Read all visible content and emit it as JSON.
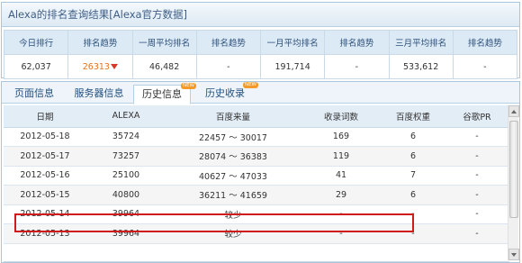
{
  "summary": {
    "title": "Alexa的排名查询结果[Alexa官方数据]",
    "headers": [
      "今日排行",
      "排名趋势",
      "一周平均排名",
      "排名趋势",
      "一月平均排名",
      "排名趋势",
      "三月平均排名",
      "排名趋势"
    ],
    "values": [
      "62,037",
      "26313",
      "46,482",
      "-",
      "191,714",
      "-",
      "533,612",
      "-"
    ],
    "trend_color": "#e9711c",
    "trend_arrow_color": "#d83a2a"
  },
  "tabs": [
    {
      "label": "页面信息",
      "active": false,
      "badge": ""
    },
    {
      "label": "服务器信息",
      "active": false,
      "badge": ""
    },
    {
      "label": "历史信息",
      "active": true,
      "badge": "NEW"
    },
    {
      "label": "历史收录",
      "active": false,
      "badge": "NEW"
    }
  ],
  "history": {
    "columns": [
      "日期",
      "ALEXA",
      "百度来量",
      "收录词数",
      "百度权重",
      "谷歌PR"
    ],
    "rows": [
      [
        "2012-05-18",
        "35724",
        "22457 ～ 30017",
        "169",
        "6",
        "-"
      ],
      [
        "2012-05-17",
        "73257",
        "28074 ～ 36383",
        "119",
        "6",
        "-"
      ],
      [
        "2012-05-16",
        "25100",
        "40627 ～ 47033",
        "41",
        "7",
        "-"
      ],
      [
        "2012-05-15",
        "40800",
        "36211 ～ 41659",
        "29",
        "6",
        "-"
      ],
      [
        "2012-05-14",
        "39964",
        "较少",
        "-",
        "-",
        "-"
      ],
      [
        "2012-05-13",
        "39964",
        "较少",
        "-",
        "-",
        "-"
      ]
    ],
    "highlighted_row_date": "2012-05-15",
    "highlight_color": "#d11a1a"
  },
  "colors": {
    "border": "#a9c6dc",
    "header_bg": "#dceaf6",
    "header_text": "#2c4f78",
    "tab_text": "#23507d",
    "badge": "#f39a2b"
  }
}
